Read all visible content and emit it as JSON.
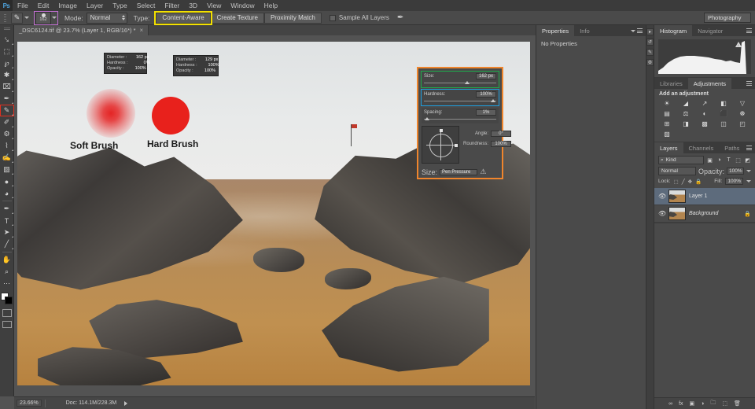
{
  "menu": {
    "logo": "Ps",
    "items": [
      "File",
      "Edit",
      "Image",
      "Layer",
      "Type",
      "Select",
      "Filter",
      "3D",
      "View",
      "Window",
      "Help"
    ]
  },
  "options_bar": {
    "brush_size_value": "162",
    "mode_label": "Mode:",
    "mode_value": "Normal",
    "type_label": "Type:",
    "buttons": [
      "Content-Aware",
      "Create Texture",
      "Proximity Match"
    ],
    "active_button": "Content-Aware",
    "sample_all_layers": "Sample All Layers",
    "workspace": "Photography",
    "highlight_color_brush": "#c06fd0",
    "highlight_color_type": "#f3e000"
  },
  "document_tab": {
    "title": "_DSC6124.tif @ 23.7% (Layer 1, RGB/16*) *",
    "close": "×"
  },
  "toolbar": {
    "tools": [
      {
        "name": "move-tool",
        "glyph": "✥"
      },
      {
        "name": "rectangular-marquee-tool",
        "glyph": "⬚"
      },
      {
        "name": "lasso-tool",
        "glyph": "℘"
      },
      {
        "name": "quick-selection-tool",
        "glyph": "✎"
      },
      {
        "name": "crop-tool",
        "glyph": "⌗"
      },
      {
        "name": "eyedropper-tool",
        "glyph": "✒"
      },
      {
        "name": "spot-healing-brush-tool",
        "glyph": "✐"
      },
      {
        "name": "brush-tool",
        "glyph": "✏"
      },
      {
        "name": "clone-stamp-tool",
        "glyph": "⚑"
      },
      {
        "name": "history-brush-tool",
        "glyph": "⌇"
      },
      {
        "name": "eraser-tool",
        "glyph": "▭"
      },
      {
        "name": "gradient-tool",
        "glyph": "▧"
      },
      {
        "name": "blur-tool",
        "glyph": "●"
      },
      {
        "name": "dodge-tool",
        "glyph": "◑"
      },
      {
        "name": "pen-tool",
        "glyph": "✒"
      },
      {
        "name": "type-tool",
        "glyph": "T"
      },
      {
        "name": "path-selection-tool",
        "glyph": "➤"
      },
      {
        "name": "line-tool",
        "glyph": "╱"
      },
      {
        "name": "hand-tool",
        "glyph": "✋"
      },
      {
        "name": "zoom-tool",
        "glyph": "⌕"
      },
      {
        "name": "edit-toolbar-tool",
        "glyph": "⋯"
      }
    ],
    "active_tool": "brush-tool",
    "active_highlight_color": "#e03020",
    "foreground_color": "#ffffff",
    "background_color": "#000000"
  },
  "canvas": {
    "soft_brush_label": "Soft Brush",
    "hard_brush_label": "Hard Brush",
    "soft_tooltip": {
      "rows": [
        {
          "key": "Diameter :",
          "value": "162 px"
        },
        {
          "key": "Hardness :",
          "value": "0%"
        },
        {
          "key": "Opacity :",
          "value": "100%"
        }
      ]
    },
    "hard_tooltip": {
      "rows": [
        {
          "key": "Diameter :",
          "value": "129 px"
        },
        {
          "key": "Hardness :",
          "value": "100%"
        },
        {
          "key": "Opacity :",
          "value": "100%"
        }
      ]
    }
  },
  "brush_panel": {
    "border_color": "#f0852c",
    "size_label": "Size:",
    "size_value": "162 px",
    "size_highlight_color": "#1faa4b",
    "hardness_label": "Hardness:",
    "hardness_value": "100%",
    "hardness_highlight_color": "#1e9fe0",
    "spacing_label": "Spacing:",
    "spacing_value": "1%",
    "angle_label": "Angle:",
    "angle_value": "0°",
    "roundness_label": "Roundness:",
    "roundness_value": "100%",
    "foot_label": "Size:",
    "foot_value": "Pen Pressure"
  },
  "status_bar": {
    "zoom": "23.66%",
    "doc_size": "Doc: 114.1M/228.3M"
  },
  "properties_panel": {
    "tabs": [
      "Properties",
      "Info"
    ],
    "active_tab": "Properties",
    "empty_message": "No Properties"
  },
  "histogram_panel": {
    "tabs": [
      "Histogram",
      "Navigator"
    ],
    "active_tab": "Histogram"
  },
  "adjustments_panel": {
    "tabs": [
      "Libraries",
      "Adjustments"
    ],
    "active_tab": "Adjustments",
    "title": "Add an adjustment",
    "icons": [
      {
        "name": "brightness-contrast-icon",
        "glyph": "☀"
      },
      {
        "name": "levels-icon",
        "glyph": "◢"
      },
      {
        "name": "curves-icon",
        "glyph": "↗"
      },
      {
        "name": "exposure-icon",
        "glyph": "◧"
      },
      {
        "name": "vibrance-icon",
        "glyph": "▽"
      },
      {
        "name": "hue-saturation-icon",
        "glyph": "▤"
      },
      {
        "name": "color-balance-icon",
        "glyph": "⚖"
      },
      {
        "name": "black-white-icon",
        "glyph": "◐"
      },
      {
        "name": "photo-filter-icon",
        "glyph": "⬛"
      },
      {
        "name": "channel-mixer-icon",
        "glyph": "☸"
      },
      {
        "name": "color-lookup-icon",
        "glyph": "⊞"
      },
      {
        "name": "invert-icon",
        "glyph": "◨"
      },
      {
        "name": "posterize-icon",
        "glyph": "▩"
      },
      {
        "name": "threshold-icon",
        "glyph": "◫"
      },
      {
        "name": "selective-color-icon",
        "glyph": "◰"
      },
      {
        "name": "gradient-map-icon",
        "glyph": "▨"
      }
    ]
  },
  "layers_panel": {
    "tabs": [
      "Layers",
      "Channels",
      "Paths"
    ],
    "active_tab": "Layers",
    "kind_filter": "Kind",
    "filter_icons": [
      "▣",
      "◑",
      "T",
      "⬚",
      "◩"
    ],
    "blend_mode": "Normal",
    "opacity_label": "Opacity:",
    "opacity_value": "100%",
    "lock_label": "Lock:",
    "lock_icons": [
      "⬚",
      "╱",
      "✥",
      "🔒"
    ],
    "fill_label": "Fill:",
    "fill_value": "100%",
    "layers": [
      {
        "name": "Layer 1",
        "selected": true,
        "locked": false,
        "visible": true
      },
      {
        "name": "Background",
        "selected": false,
        "locked": true,
        "visible": true
      }
    ],
    "footer_icons": [
      {
        "name": "link-layers-icon",
        "glyph": "∞"
      },
      {
        "name": "layer-style-icon",
        "glyph": "fx"
      },
      {
        "name": "add-mask-icon",
        "glyph": "▣"
      },
      {
        "name": "adjustment-layer-icon",
        "glyph": "◑"
      },
      {
        "name": "new-group-icon",
        "glyph": "🗀"
      },
      {
        "name": "new-layer-icon",
        "glyph": "⬚"
      },
      {
        "name": "delete-layer-icon",
        "glyph": "🗑"
      }
    ]
  }
}
